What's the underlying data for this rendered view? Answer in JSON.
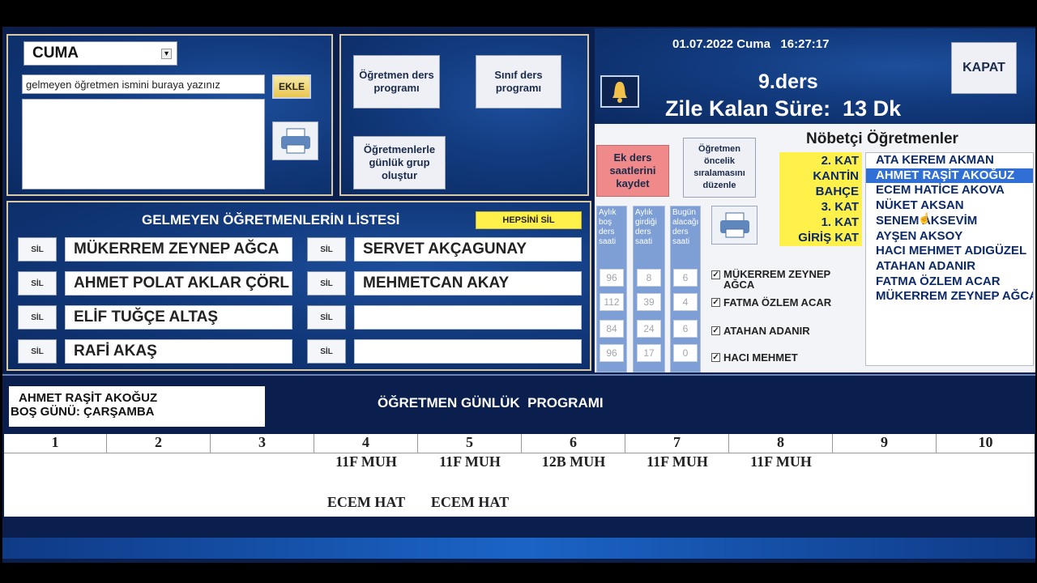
{
  "day_select": {
    "value": "CUMA"
  },
  "teacher_input": {
    "value": "gelmeyen öğretmen ismini buraya yazınız"
  },
  "add_label": "EKLE",
  "buttons": {
    "teacher_program": "Öğretmen ders programı",
    "class_program": "Sınıf ders programı",
    "group_create": "Öğretmenlerle günlük grup oluştur",
    "extra_hours": "Ek ders saatlerini kaydet",
    "priority": "Öğretmen öncelik sıralamasını düzenle",
    "close": "KAPAT"
  },
  "absent": {
    "title": "GELMEYEN ÖĞRETMENLERİN LİSTESİ",
    "delete_all": "HEPSİNİ SİL",
    "sil_label": "SİL",
    "left": [
      "MÜKERREM ZEYNEP AĞCA",
      "AHMET POLAT AKLAR ÇÖRL",
      "ELİF TUĞÇE ALTAŞ",
      "RAFİ AKAŞ"
    ],
    "right": [
      "SERVET AKÇAGUNAY",
      "MEHMETCAN AKAY",
      "",
      ""
    ]
  },
  "header": {
    "datetime": "01.07.2022 Cuma   16:27:17",
    "lesson": "9.ders",
    "bell_remaining": "Zile Kalan Süre:  13 Dk"
  },
  "duty": {
    "title": "Nöbetçi Öğretmenler",
    "floors": [
      "2. KAT",
      "KANTİN",
      "BAHÇE",
      "3. KAT",
      "1. KAT",
      "GİRİŞ KAT"
    ],
    "list": [
      "ATA KEREM AKMAN",
      "AHMET RAŞİT AKOĞUZ",
      "ECEM HATİCE AKOVA",
      "NÜKET AKSAN",
      "SENEM AKSEVİM",
      "AYŞEN AKSOY",
      "HACI MEHMET ADIGÜZEL",
      "ATAHAN ADANIR",
      "FATMA ÖZLEM ACAR",
      "MÜKERREM ZEYNEP AĞCA"
    ],
    "selected_index": 1
  },
  "stats": {
    "headers": [
      "Aylık boş ders saati",
      "Aylık girdiği ders saati",
      "Bugün alacağı ders saati"
    ],
    "rows": [
      [
        "96",
        "8",
        "6"
      ],
      [
        "112",
        "39",
        "4"
      ],
      [
        "84",
        "24",
        "6"
      ],
      [
        "96",
        "17",
        "0"
      ]
    ]
  },
  "checked": [
    "MÜKERREM ZEYNEP AĞCA",
    "FATMA ÖZLEM ACAR",
    "ATAHAN ADANIR",
    "HACI MEHMET"
  ],
  "program": {
    "teacher": "AHMET RAŞİT AKOĞUZ",
    "free_day": "BOŞ GÜNÜ: ÇARŞAMBA",
    "title": "ÖĞRETMEN GÜNLÜK  PROGRAMI",
    "periods": [
      "1",
      "2",
      "3",
      "4",
      "5",
      "6",
      "7",
      "8",
      "9",
      "10"
    ],
    "classes": [
      "",
      "",
      "",
      "11F MUH",
      "11F MUH",
      "12B MUH",
      "11F MUH",
      "11F MUH",
      "",
      ""
    ],
    "pairs": [
      "",
      "",
      "",
      "ECEM HAT",
      "ECEM HAT",
      "",
      "",
      "",
      "",
      ""
    ]
  },
  "colors": {
    "accent_yellow": "#fff04a",
    "red_button": "#f08a8a",
    "selection": "#2f6fd6"
  }
}
